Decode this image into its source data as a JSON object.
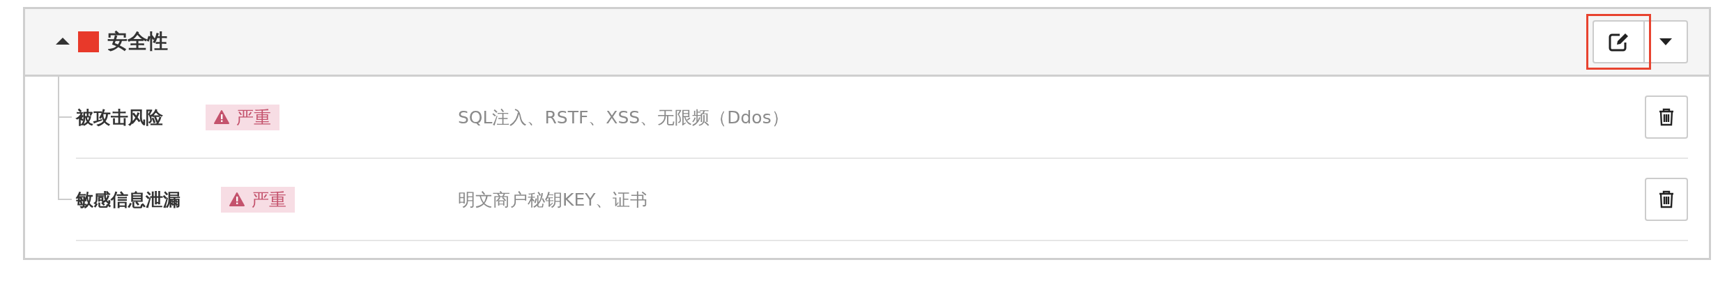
{
  "section": {
    "title": "安全性",
    "color": "#e8392a",
    "expanded": true,
    "actions": {
      "edit_highlighted": true
    },
    "items": [
      {
        "name": "被攻击风险",
        "severity": "严重",
        "description": "SQL注入、RSTF、XSS、无限频（Ddos）"
      },
      {
        "name": "敏感信息泄漏",
        "severity": "严重",
        "description": "明文商户秘钥KEY、证书"
      }
    ]
  }
}
